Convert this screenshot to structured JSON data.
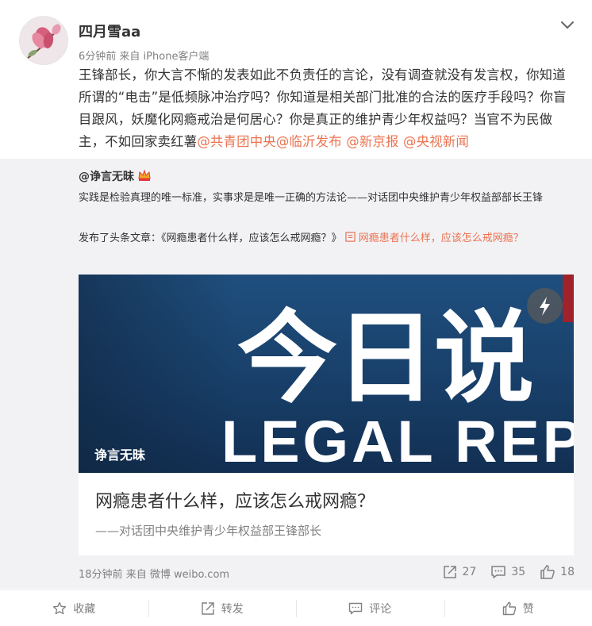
{
  "post": {
    "username": "四月雪aa",
    "time": "6分钟前",
    "source": "来自 iPhone客户端",
    "text_plain": "王锋部长，你大言不惭的发表如此不负责任的言论，没有调查就没有发言权，你知道所谓的“电击”是低频脉冲治疗吗？你知道是相关部门批准的合法的医疗手段吗？你盲目跟风，妖魔化网瘾戒治是何居心？你是真正的维护青少年权益吗？当官不为民做主，不如回家卖红薯",
    "mentions": [
      "@共青团中央",
      "@临沂发布",
      " @新京报",
      " @央视新闻"
    ]
  },
  "repost": {
    "username": "@诤言无昧",
    "text": "实践是检验真理的唯一标准，实事求是是唯一正确的方法论——对话团中央维护青少年权益部部长王锋",
    "article_prefix": "发布了头条文章：《网瘾患者什么样，应该怎么戒网瘾？》",
    "article_link": " 网瘾患者什么样，应该怎么戒网瘾？",
    "card": {
      "image_text_cn": "今日说",
      "image_text_en": "LEGAL REP",
      "image_source": "诤言无昧",
      "title": "网瘾患者什么样，应该怎么戒网瘾？",
      "subtitle": "——对话团中央维护青少年权益部王锋部长"
    },
    "time": "18分钟前",
    "source": "来自 微博 weibo.com",
    "reposts": "27",
    "comments": "35",
    "likes": "18"
  },
  "actions": {
    "favorite": "收藏",
    "repost": "转发",
    "comment": "评论",
    "like": "赞"
  },
  "colors": {
    "link": "#eb7350",
    "repost_bg": "#f2f2f5",
    "meta_gray": "#808080"
  }
}
